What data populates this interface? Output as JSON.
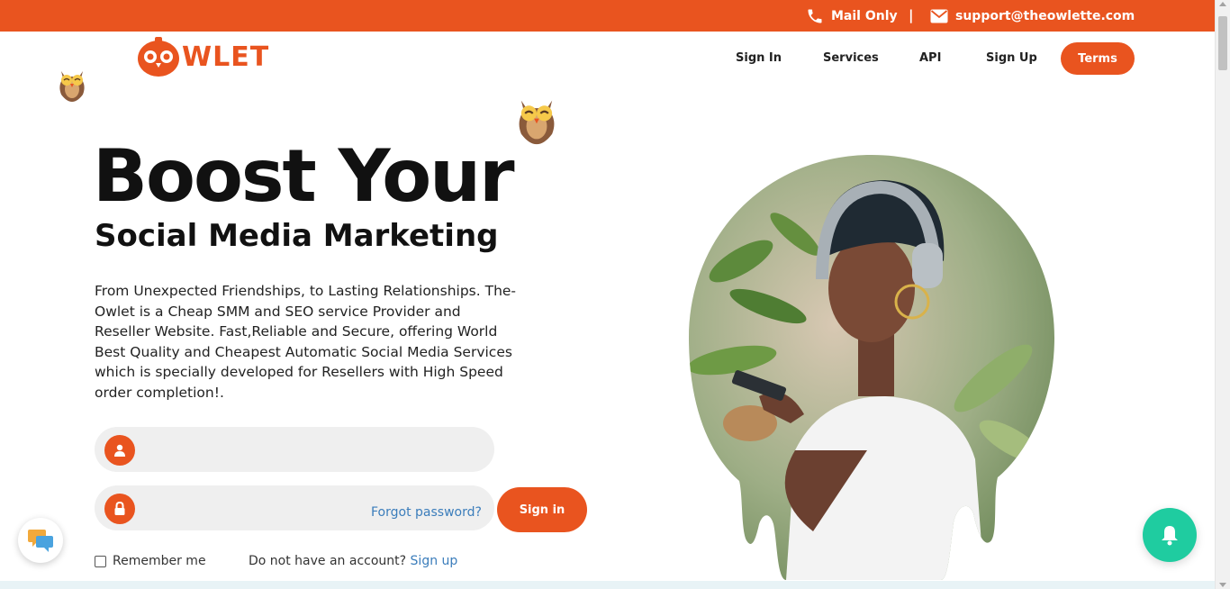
{
  "topbar": {
    "phone_text": "Mail Only",
    "separator": "|",
    "email": "support@theowlette.com"
  },
  "brand": {
    "logo_text": "WLET",
    "accent_color": "#e9541f",
    "success_color": "#1fcca0"
  },
  "nav": {
    "items": [
      {
        "label": "Sign In"
      },
      {
        "label": "Services"
      },
      {
        "label": "API"
      },
      {
        "label": "Sign Up"
      }
    ],
    "terms_label": "Terms"
  },
  "hero": {
    "title": "Boost Your",
    "subtitle": "Social Media Marketing",
    "description": "From Unexpected Friendships, to Lasting Relationships. The-Owlet is a Cheap SMM and SEO service Provider and Reseller Website. Fast,Reliable and Secure, offering World Best Quality and Cheapest Automatic Social Media Services which is specially developed for Resellers with High Speed order completion!."
  },
  "login": {
    "username_value": "",
    "password_value": "",
    "forgot_label": "Forgot password?",
    "signin_label": "Sign in",
    "remember_label": "Remember me",
    "no_account_text": "Do not have an account?",
    "signup_label": "Sign up"
  },
  "icons": {
    "phone": "phone-icon",
    "mail": "envelope-icon",
    "user": "user-icon",
    "lock": "lock-icon",
    "chat": "chat-bubbles-icon",
    "bell": "bell-icon",
    "owl": "owl-mascot-icon"
  }
}
